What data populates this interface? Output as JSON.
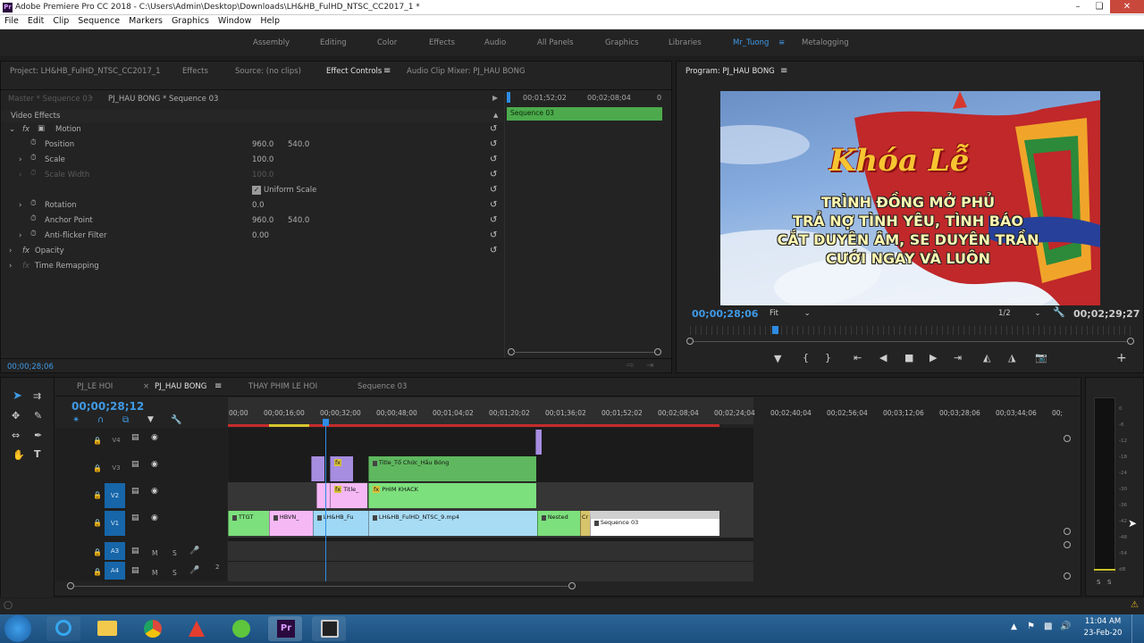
{
  "window": {
    "title": "Adobe Premiere Pro CC 2018 - C:\\Users\\Admin\\Desktop\\Downloads\\LH&HB_FulHD_NTSC_CC2017_1 *",
    "logo": "Pr"
  },
  "menu": [
    "File",
    "Edit",
    "Clip",
    "Sequence",
    "Markers",
    "Graphics",
    "Window",
    "Help"
  ],
  "workspaces": [
    "Assembly",
    "Editing",
    "Color",
    "Effects",
    "Audio",
    "All Panels",
    "Graphics",
    "Libraries",
    "Mr_Tuong",
    "Metalogging"
  ],
  "active_workspace": "Mr_Tuong",
  "source_panel": {
    "tabs": [
      "Project: LH&HB_FulHD_NTSC_CC2017_1",
      "Effects",
      "Source: (no clips)",
      "Effect Controls",
      "Audio Clip Mixer: PJ_HAU BONG"
    ],
    "master": "Master * Sequence 03",
    "clip": "PJ_HAU BONG * Sequence 03",
    "ruler": [
      "00;01;52;02",
      "00;02;08;04",
      "0"
    ],
    "seq_clip": "Sequence 03",
    "video_effects": "Video Effects",
    "motion": "Motion",
    "rows": [
      {
        "label": "Position",
        "v1": "960.0",
        "v2": "540.0"
      },
      {
        "label": "Scale",
        "v1": "100.0",
        "v2": ""
      },
      {
        "label": "Scale Width",
        "v1": "100.0",
        "v2": ""
      },
      {
        "label": "Uniform Scale",
        "v1": "",
        "v2": ""
      },
      {
        "label": "Rotation",
        "v1": "0.0",
        "v2": ""
      },
      {
        "label": "Anchor Point",
        "v1": "960.0",
        "v2": "540.0"
      },
      {
        "label": "Anti-flicker Filter",
        "v1": "0.00",
        "v2": ""
      }
    ],
    "opacity": "Opacity",
    "time_remapping": "Time Remapping",
    "timecode": "00;00;28;06"
  },
  "program": {
    "title": "Program: PJ_HAU BONG",
    "timecode": "00;00;28;06",
    "fit": "Fit",
    "res": "1/2",
    "duration": "00;02;29;27",
    "frame": {
      "logo_text": "Khóa Lễ",
      "lines": [
        "TRÌNH ĐỒNG MỞ PHỦ",
        "TRẢ NỢ TÌNH YÊU, TÌNH BÁO",
        "CẮT DUYÊN ÂM, SE DUYÊN TRẦN",
        "CƯỚI NGAY VÀ LUÔN"
      ]
    }
  },
  "timeline": {
    "tabs": [
      "PJ_LE HOI",
      "PJ_HAU BONG",
      "THAY PHIM LE HOI",
      "Sequence 03"
    ],
    "active_tab": "PJ_HAU BONG",
    "timecode": "00;00;28;12",
    "ruler": [
      "00;00",
      "00;00;16;00",
      "00;00;32;00",
      "00;00;48;00",
      "00;01;04;02",
      "00;01;20;02",
      "00;01;36;02",
      "00;01;52;02",
      "00;02;08;04",
      "00;02;24;04",
      "00;02;40;04",
      "00;02;56;04",
      "00;03;12;06",
      "00;03;28;06",
      "00;03;44;06",
      "00;"
    ],
    "tracks": [
      {
        "id": "V4"
      },
      {
        "id": "V3"
      },
      {
        "id": "V2"
      },
      {
        "id": "V1"
      },
      {
        "id": "A3",
        "m": "M",
        "s": "S"
      },
      {
        "id": "A4",
        "m": "M",
        "s": "S"
      }
    ],
    "clips": {
      "v3_title": "Title_Tổ Chức_Hầu Bóng",
      "v2_title": "Title_",
      "v2_phim": "PHIM KHACK",
      "v1": [
        "TTGT",
        "HBVN_",
        "LH&HB_Fu",
        "LH&HB_FulHD_NTSC_9.mp4",
        "Nested",
        "Cr",
        "Sequence 03"
      ]
    },
    "a4_num": "2"
  },
  "meter": {
    "scale": [
      "0",
      "-6",
      "-12",
      "-18",
      "-24",
      "-30",
      "-36",
      "-42",
      "-48",
      "-54",
      "dB"
    ],
    "solo": [
      "S",
      "S"
    ]
  },
  "taskbar": {
    "time": "11:04 AM",
    "date": "23-Feb-20"
  }
}
